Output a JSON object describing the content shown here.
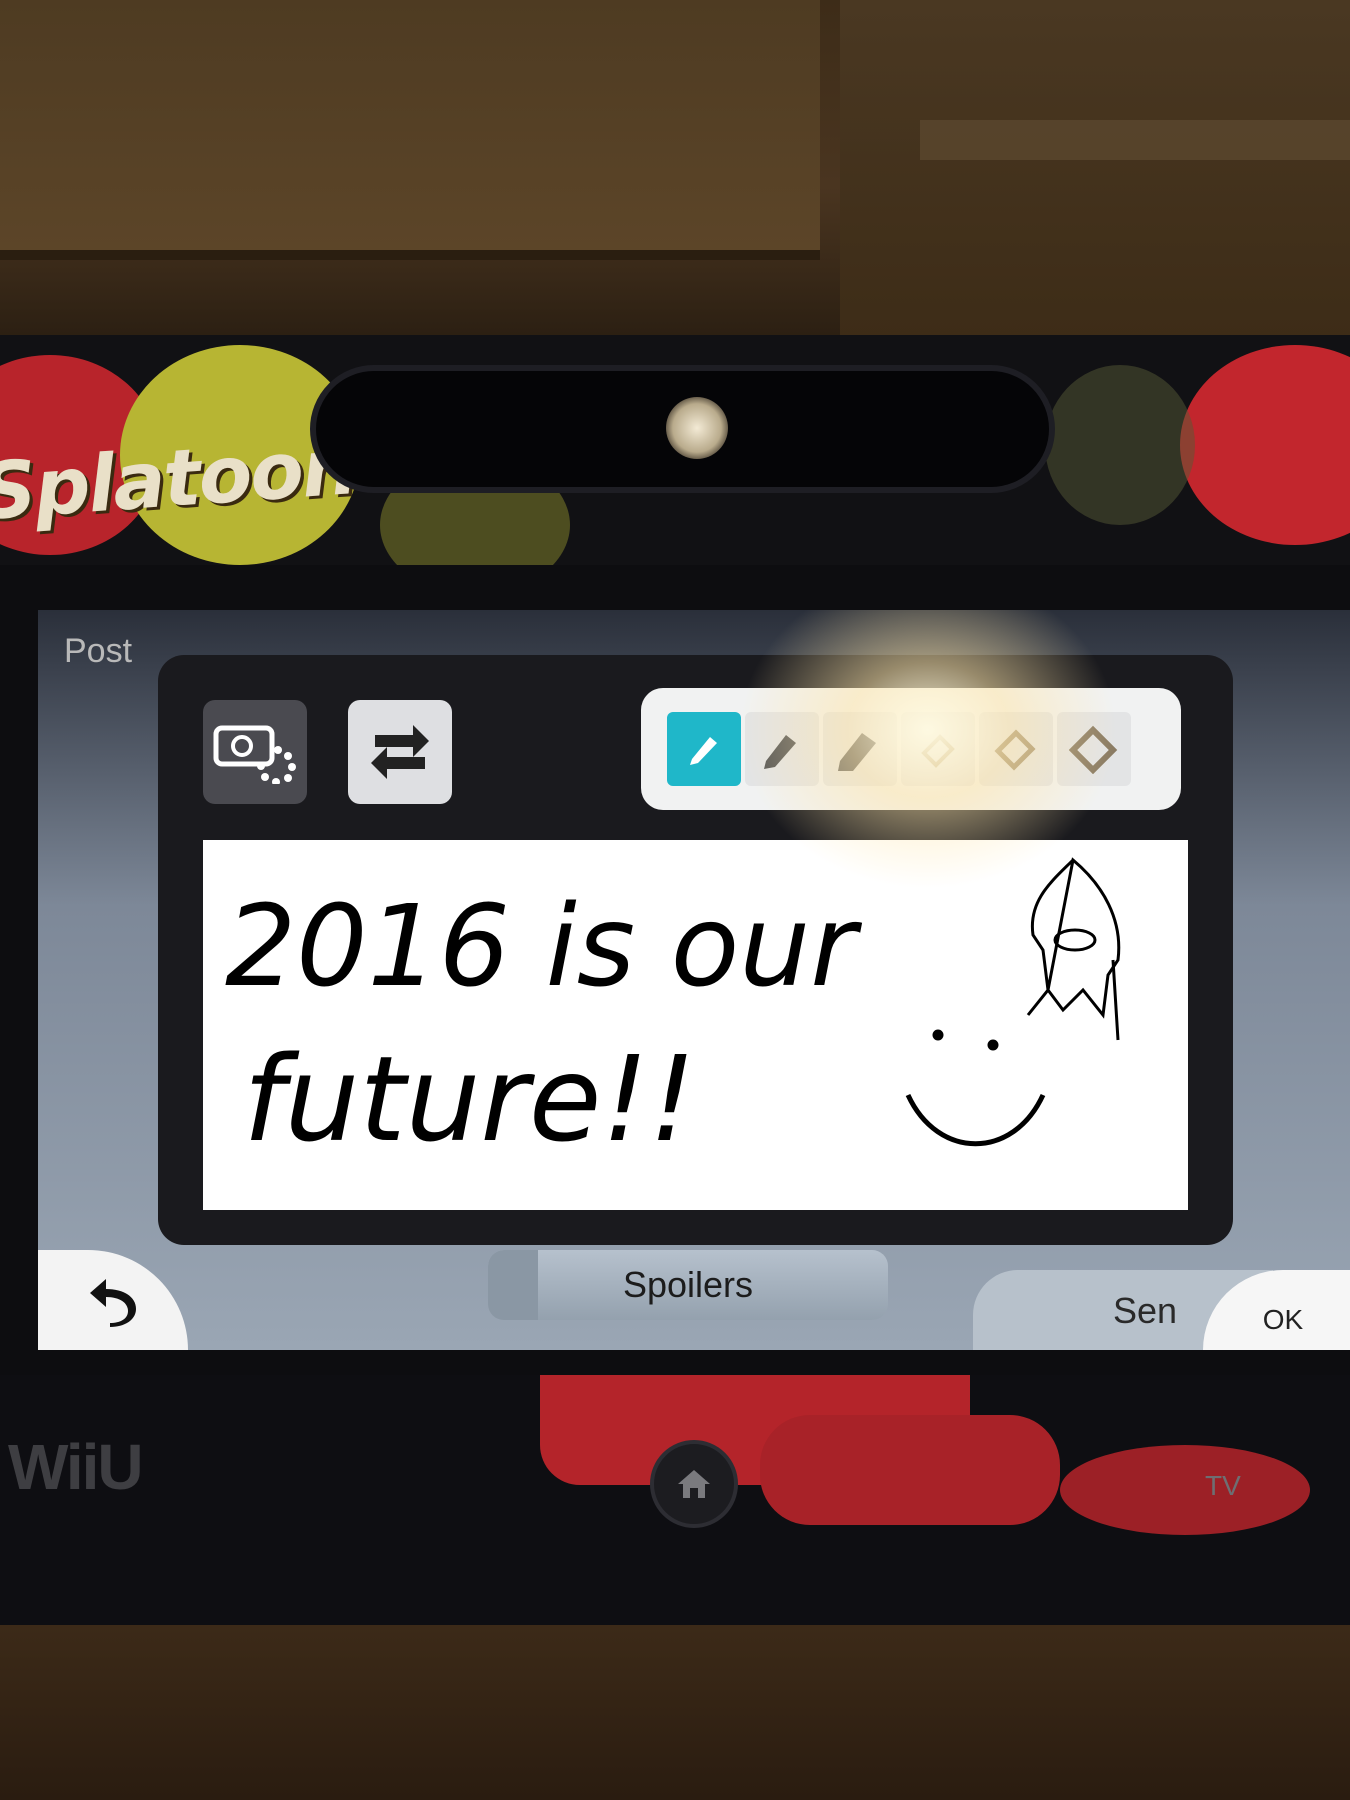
{
  "header": {
    "brand_logo_text": "Splatoon"
  },
  "screen": {
    "post_label": "Post",
    "toolbar": {
      "replay_icon": "camera-replay-icon",
      "swap_icon": "swap-arrows-icon",
      "palette": [
        {
          "name": "pen-thin",
          "active": true
        },
        {
          "name": "pen-medium",
          "active": false
        },
        {
          "name": "pen-thick",
          "active": false
        },
        {
          "name": "eraser-thin",
          "active": false
        },
        {
          "name": "eraser-medium",
          "active": false
        },
        {
          "name": "eraser-thick",
          "active": false
        }
      ]
    },
    "canvas": {
      "line1": "2016 is our",
      "line2": "future!!"
    },
    "bottom_bar": {
      "back_icon": "undo-arrow-icon",
      "spoilers_label": "Spoilers",
      "send_label": "Sen",
      "ok_label": "OK"
    }
  },
  "gamepad": {
    "console_logo": "WiiU",
    "tv_label": "TV"
  },
  "colors": {
    "accent": "#1fb7c9",
    "canvas": "#ffffff",
    "ink": "#000000"
  }
}
